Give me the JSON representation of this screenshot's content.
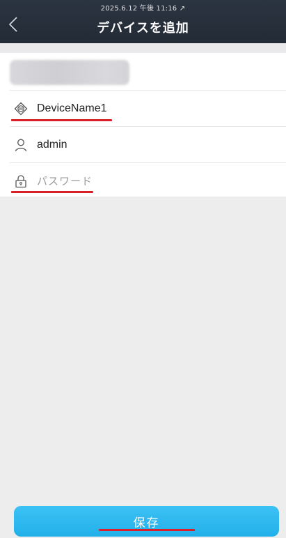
{
  "header": {
    "timestamp": "2025.6.12 午後 11:16 ↗",
    "title": "デバイスを追加"
  },
  "form": {
    "device_name": "DeviceName1",
    "username": "admin",
    "password_placeholder": "パスワード"
  },
  "footer": {
    "save_label": "保存"
  },
  "colors": {
    "header_bg": "#262f3b",
    "accent": "#2ab5ef",
    "annotation_red": "#d81f2a"
  }
}
